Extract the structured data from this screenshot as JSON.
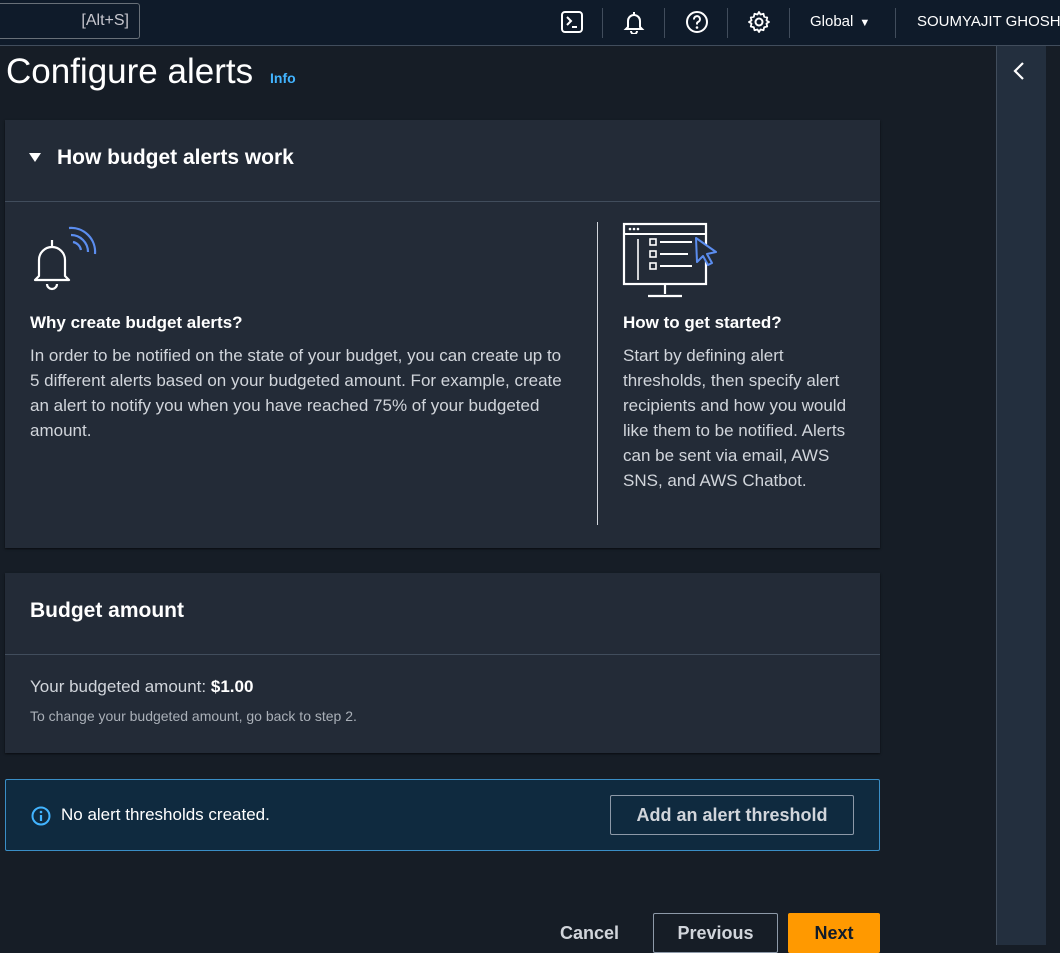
{
  "topbar": {
    "search_shortcut": "[Alt+S]",
    "region_label": "Global",
    "user_name": "SOUMYAJIT GHOSH",
    "icons": [
      "cloudshell-icon",
      "bell-icon",
      "help-icon",
      "gear-icon"
    ]
  },
  "page": {
    "title": "Configure alerts",
    "info_link": "Info"
  },
  "how_it_works": {
    "heading": "How budget alerts work",
    "left": {
      "title": "Why create budget alerts?",
      "body": "In order to be notified on the state of your budget, you can create up to 5 different alerts based on your budgeted amount. For example, create an alert to notify you when you have reached 75% of your budgeted amount."
    },
    "right": {
      "title": "How to get started?",
      "body": "Start by defining alert thresholds, then specify alert recipients and how you would like them to be notified. Alerts can be sent via email, AWS SNS, and AWS Chatbot."
    }
  },
  "budget_amount": {
    "heading": "Budget amount",
    "label": "Your budgeted amount:",
    "value": "$1.00",
    "hint": "To change your budgeted amount, go back to step 2."
  },
  "alerts": {
    "empty_message": "No alert thresholds created.",
    "add_button": "Add an alert threshold"
  },
  "footer": {
    "cancel": "Cancel",
    "previous": "Previous",
    "next": "Next"
  },
  "colors": {
    "accent": "#ff9900",
    "info_blue": "#42b4ff",
    "icon_accent": "#5b8def"
  }
}
